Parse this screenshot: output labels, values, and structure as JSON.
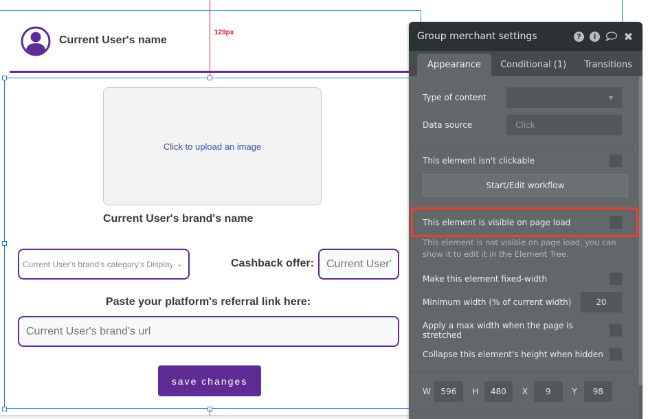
{
  "canvas": {
    "user_name": "Current User's name",
    "spacing_indicator": "129px",
    "upload_prompt": "Click to upload an image",
    "brand_name": "Current User's brand's name",
    "category_dropdown": {
      "selected": "Current User's brand's category's Display"
    },
    "cashback_label": "Cashback offer:",
    "cashback_input": {
      "placeholder": "Current User's",
      "value": ""
    },
    "referral_label": "Paste your platform's referral link here:",
    "url_input": {
      "placeholder": "Current User's brand's url",
      "value": ""
    },
    "save_button": "save changes",
    "accent_color": "#5e2c94"
  },
  "panel": {
    "title": "Group merchant settings",
    "header_icons": [
      "help-icon",
      "info-icon",
      "comment-icon",
      "close-icon"
    ],
    "tabs": [
      {
        "label": "Appearance",
        "active": true
      },
      {
        "label": "Conditional (1)",
        "active": false
      },
      {
        "label": "Transitions",
        "active": false
      }
    ],
    "type_of_content": {
      "label": "Type of content",
      "value": ""
    },
    "data_source": {
      "label": "Data source",
      "placeholder": "Click"
    },
    "not_clickable": {
      "label": "This element isn't clickable",
      "checked": false
    },
    "workflow_button": "Start/Edit workflow",
    "visible_on_load": {
      "label": "This element is visible on page load",
      "checked": false
    },
    "visibility_note": "This element is not visible on page load, you can show it to edit it in the Element Tree.",
    "fixed_width": {
      "label": "Make this element fixed-width",
      "checked": false
    },
    "min_width": {
      "label": "Minimum width (% of current width)",
      "value": "20"
    },
    "max_width": {
      "label": "Apply a max width when the page is stretched",
      "checked": false
    },
    "collapse_height": {
      "label": "Collapse this element's height when hidden",
      "checked": false
    },
    "dimensions": {
      "w_label": "W",
      "w": "596",
      "h_label": "H",
      "h": "480",
      "x_label": "X",
      "x": "9",
      "y_label": "Y",
      "y": "98"
    },
    "highlight_color": "#e8412c"
  }
}
